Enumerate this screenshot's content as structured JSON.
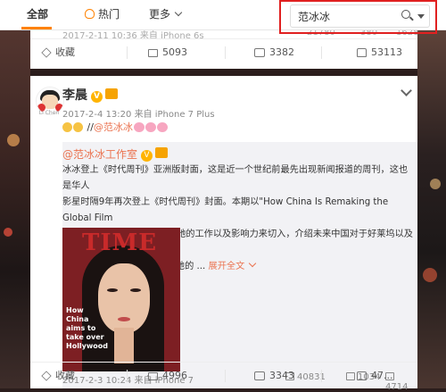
{
  "tabs": {
    "all": "全部",
    "hot": "热门",
    "more": "更多"
  },
  "search": {
    "value": "范冰冰"
  },
  "post1": {
    "meta_partial": "2017-2-11 10:36 来自 iPhone 6s",
    "counts_partial": [
      "21780",
      "380",
      "1628"
    ],
    "actions": {
      "favorite": "收藏",
      "share": "5093",
      "comment": "3382",
      "like": "53113"
    }
  },
  "post2": {
    "author": "李晨",
    "avatar_caption": "Li Chen",
    "meta": "2017-2-4 13:20 来自 iPhone 7 Plus",
    "body_prefix": "//",
    "mention": "@范冰冰",
    "repost": {
      "author": "@范冰冰工作室",
      "text": "冰冰登上《时代周刊》亚洲版封面，这是近一个世纪前最先出现新闻报道的周刊，这也是华人\n影星时隔9年再次登上《时代周刊》封面。本期以\"How China Is Remaking the Global Film\nIndustry\"为题，通过冰冰和她的工作以及影响力来切入，介绍未来中国对于好莱坞以及全球电\n影市场的巨大影响，更盛赞\"她的 ...",
      "expand": "展开全文",
      "photo_title": "TIME",
      "photo_caption": "How\nChina\naims to\ntake over\nHollywood",
      "meta": "2017-2-3 10:24 来自 iPhone 7",
      "counts": [
        "40831",
        "1034",
        "4714"
      ]
    },
    "actions": {
      "favorite": "收藏",
      "share": "4996",
      "comment": "3343",
      "like": "47..."
    }
  },
  "colors": {
    "accent": "#ff8200",
    "link": "#eb7350",
    "highlight": "#e02020"
  }
}
